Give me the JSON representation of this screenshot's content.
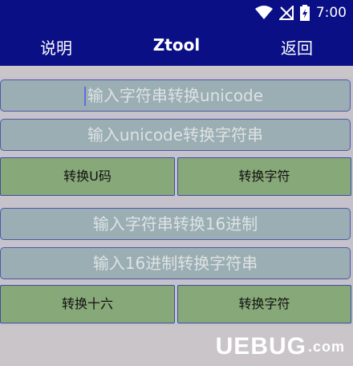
{
  "status_bar": {
    "time": "7:00",
    "icons": [
      "wifi-icon",
      "no-signal-icon",
      "battery-icon"
    ]
  },
  "toolbar": {
    "left_label": "说明",
    "title": "Ztool",
    "right_label": "返回"
  },
  "section1": {
    "input1_placeholder": "输入字符串转换unicode",
    "input2_placeholder": "输入unicode转换字符串",
    "button_left": "转换U码",
    "button_right": "转换字符"
  },
  "section2": {
    "input1_placeholder": "输入字符串转换16进制",
    "input2_placeholder": "输入16进制转换字符串",
    "button_left": "转换十六",
    "button_right": "转换字符"
  },
  "watermark": {
    "brand": "UEBUG",
    "suffix": ".com"
  },
  "colors": {
    "toolbar": "#0a0f86",
    "field": "#9aaeb3",
    "button": "#87a878",
    "border": "#5257a6"
  }
}
